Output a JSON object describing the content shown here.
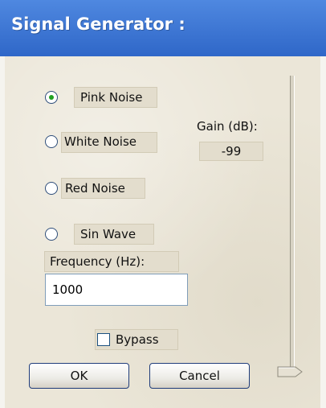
{
  "window": {
    "title": "Signal Generator :"
  },
  "noise": {
    "options": [
      {
        "label": "Pink Noise",
        "selected": true
      },
      {
        "label": "White Noise",
        "selected": false
      },
      {
        "label": "Red Noise",
        "selected": false
      },
      {
        "label": "Sin Wave",
        "selected": false
      }
    ]
  },
  "gain": {
    "label": "Gain (dB):",
    "value": "-99",
    "slider_level": 0.0
  },
  "frequency": {
    "label": "Frequency (Hz):",
    "value": "1000"
  },
  "bypass": {
    "label": "Bypass",
    "checked": false
  },
  "buttons": {
    "ok": "OK",
    "cancel": "Cancel"
  },
  "colors": {
    "title_bar": "#3a75d8",
    "radio_selected": "#21a121",
    "panel": "#ebe6d8"
  }
}
